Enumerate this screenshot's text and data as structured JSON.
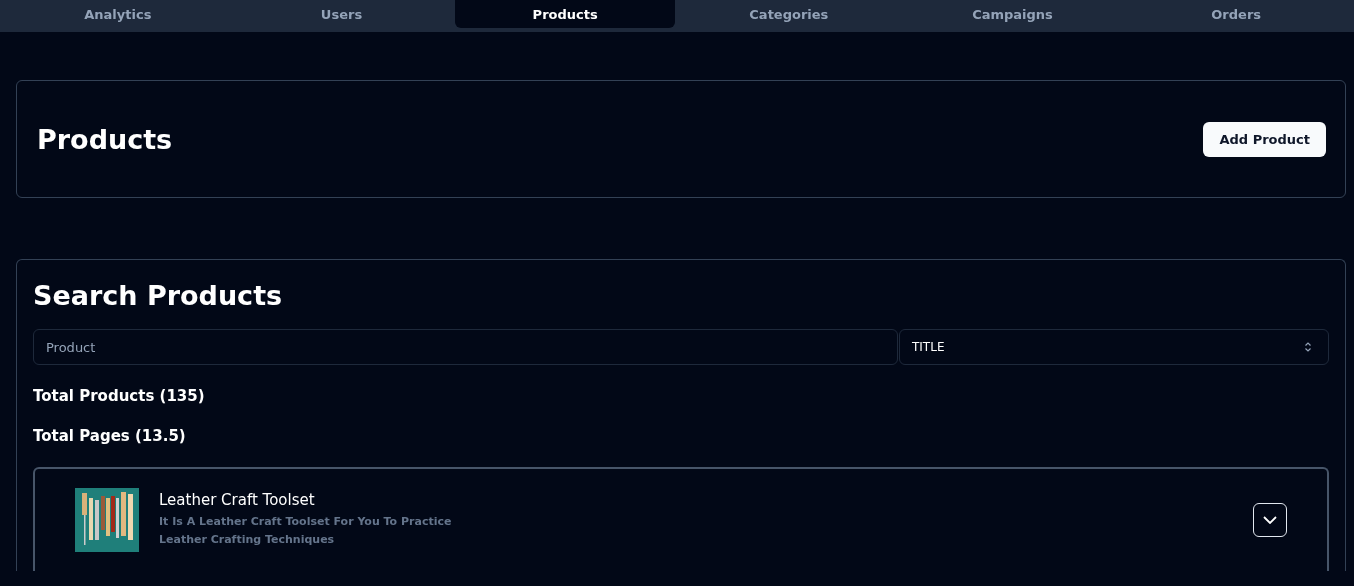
{
  "tabs": [
    {
      "label": "Analytics",
      "selected": false
    },
    {
      "label": "Users",
      "selected": false
    },
    {
      "label": "Products",
      "selected": true
    },
    {
      "label": "Categories",
      "selected": false
    },
    {
      "label": "Campaigns",
      "selected": false
    },
    {
      "label": "Orders",
      "selected": false
    }
  ],
  "header": {
    "title": "Products",
    "button": "Add Product"
  },
  "search": {
    "title": "Search Products",
    "placeholder": "Product",
    "filter": "TITLE",
    "total_products": "Total Products (135)",
    "total_pages": "Total Pages (13.5)"
  },
  "products": [
    {
      "kind": "picture",
      "name": "Leather Craft Toolset",
      "description": "It Is A Leather Craft Toolset For You To Practice Leather Crafting Techniques",
      "expanded": false
    }
  ]
}
